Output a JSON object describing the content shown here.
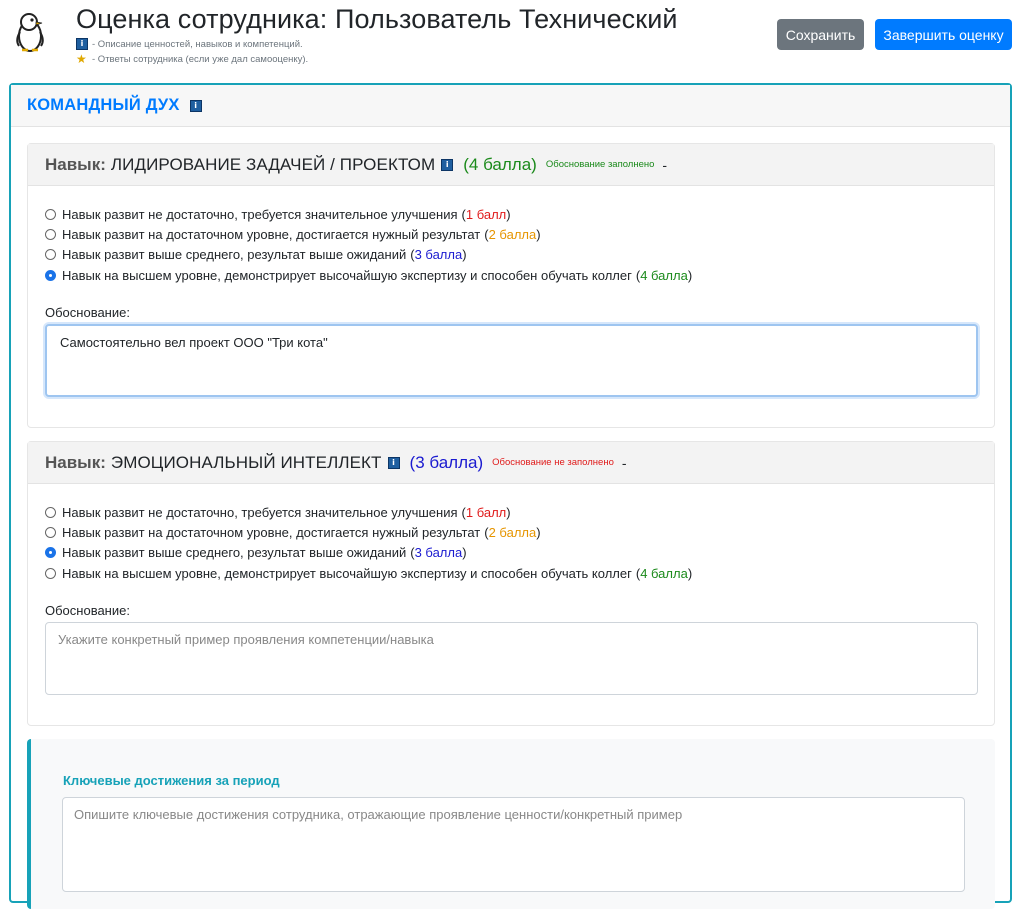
{
  "header": {
    "title": "Оценка сотрудника: Пользователь Технический",
    "legend_info": "- Описание ценностей, навыков и компетенций.",
    "legend_star": "- Ответы сотрудника (если уже дал самооценку).",
    "save_label": "Сохранить",
    "finish_label": "Завершить оценку",
    "logo_icon": "penguin-icon"
  },
  "section": {
    "title": "КОМАНДНЫЙ ДУХ",
    "info_icon": "info-icon"
  },
  "skill_prefix": "Навык:",
  "justification_label": "Обоснование:",
  "options": [
    {
      "text": "Навык развит не достаточно, требуется значительное улучшения",
      "open": "(",
      "points": "1 балл",
      "close": ")"
    },
    {
      "text": "Навык развит на достаточном уровне, достигается нужный результат",
      "open": "(",
      "points": "2 балла",
      "close": ")"
    },
    {
      "text": "Навык развит выше среднего, результат выше ожиданий",
      "open": "(",
      "points": "3 балла",
      "close": ")"
    },
    {
      "text": "Навык на высшем уровне, демонстрирует высочайшую экспертизу и способен обучать коллег",
      "open": "(",
      "points": "4 балла",
      "close": ")"
    }
  ],
  "skills": [
    {
      "name": "ЛИДИРОВАНИЕ ЗАДАЧЕЙ / ПРОЕКТОМ",
      "score": "(4 балла)",
      "score_color": "#1b8a1b",
      "status": "Обоснование заполнено",
      "status_color": "#1b8a1b",
      "dash": "-",
      "selected_option": 4,
      "justification_value": "Самостоятельно вел проект ООО \"Три кота\"",
      "justification_placeholder": ""
    },
    {
      "name": "ЭМОЦИОНАЛЬНЫЙ ИНТЕЛЛЕКТ",
      "score": "(3 балла)",
      "score_color": "#1a1ad0",
      "status": "Обоснование не заполнено",
      "status_color": "#e01b1b",
      "dash": "-",
      "selected_option": 3,
      "justification_value": "",
      "justification_placeholder": "Укажите конкретный пример проявления компетенции/навыка"
    }
  ],
  "achievements": {
    "title": "Ключевые достижения за период",
    "placeholder": "Опишите ключевые достижения сотрудника, отражающие проявление ценности/конкретный пример",
    "value": ""
  },
  "colors": {
    "primary": "#007bff",
    "secondary": "#6c757d",
    "accent": "#17a2b8",
    "point_1": "#e01b1b",
    "point_2": "#e69500",
    "point_3": "#1a1ad0",
    "point_4": "#1b8a1b"
  }
}
